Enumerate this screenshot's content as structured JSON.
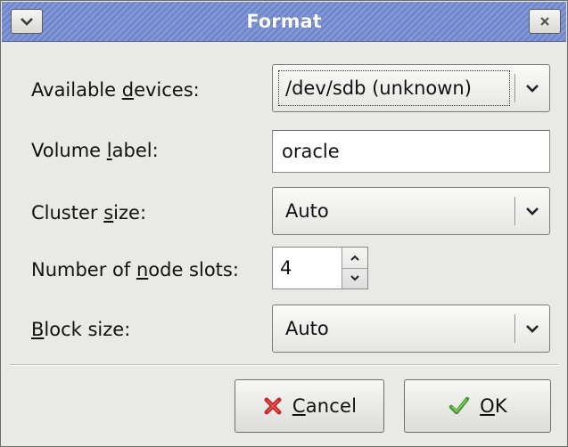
{
  "window": {
    "title": "Format",
    "menu_icon": "chevron-down-icon",
    "close_icon": "close-icon"
  },
  "form": {
    "devices": {
      "label_pre": "Available ",
      "label_mn": "d",
      "label_post": "evices:",
      "value": "/dev/sdb (unknown)"
    },
    "volume": {
      "label_pre": "Volume ",
      "label_mn": "l",
      "label_post": "abel:",
      "value": "oracle"
    },
    "cluster": {
      "label_pre": "Cluster ",
      "label_mn": "s",
      "label_post": "ize:",
      "value": "Auto"
    },
    "nodes": {
      "label_pre": "Number of ",
      "label_mn": "n",
      "label_post": "ode slots:",
      "value": "4"
    },
    "block": {
      "label_pre": "",
      "label_mn": "B",
      "label_post": "lock size:",
      "value": "Auto"
    }
  },
  "buttons": {
    "cancel": {
      "mn": "C",
      "rest": "ancel",
      "icon": "cancel-x-icon",
      "icon_color": "#c62828"
    },
    "ok": {
      "mn": "O",
      "rest": "K",
      "icon": "checkmark-icon",
      "icon_color": "#3f9b2c"
    }
  },
  "colors": {
    "titlebar": "#7a90d0",
    "dialog_bg": "#e9e9e6"
  }
}
